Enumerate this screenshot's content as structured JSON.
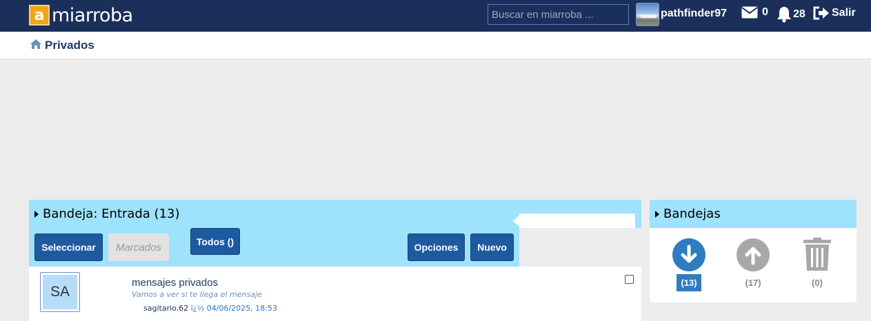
{
  "header": {
    "logo_mark": "a",
    "logo_text": "miarroba",
    "search_placeholder": "Buscar en miarroba ...",
    "username": "pathfinder97",
    "messages_count": "0",
    "notifications_count": "28",
    "logout_label": "Salir"
  },
  "breadcrumb": {
    "label": "Privados"
  },
  "inbox": {
    "title": "Bandeja: Entrada (13)",
    "select_button": "Seleccionar",
    "marked_button": "Marcados",
    "filter_button": "Todos ()",
    "options_button": "Opciones",
    "new_button": "Nuevo",
    "messages": [
      {
        "avatar_initials": "SA",
        "subject": "mensajes privados",
        "preview": "Vamos a ver si te llega el mensaje",
        "author": "sagitario.62",
        "date": "ï¿½ 04/06/2025, 18:53"
      }
    ]
  },
  "folders": {
    "title": "Bandejas",
    "items": [
      {
        "icon": "inbox-down-arrow-icon",
        "count": "(13)",
        "active": true,
        "color": "#2f7cc0"
      },
      {
        "icon": "outbox-up-arrow-icon",
        "count": "(17)",
        "active": false,
        "color": "#a8a8a8"
      },
      {
        "icon": "trash-icon",
        "count": "(0)",
        "active": false,
        "color": "#a8a8a8"
      }
    ]
  },
  "colors": {
    "topbar": "#1a2f5a",
    "panel_header": "#9ee2fb",
    "button": "#1e5aa0",
    "background": "#ececec"
  }
}
